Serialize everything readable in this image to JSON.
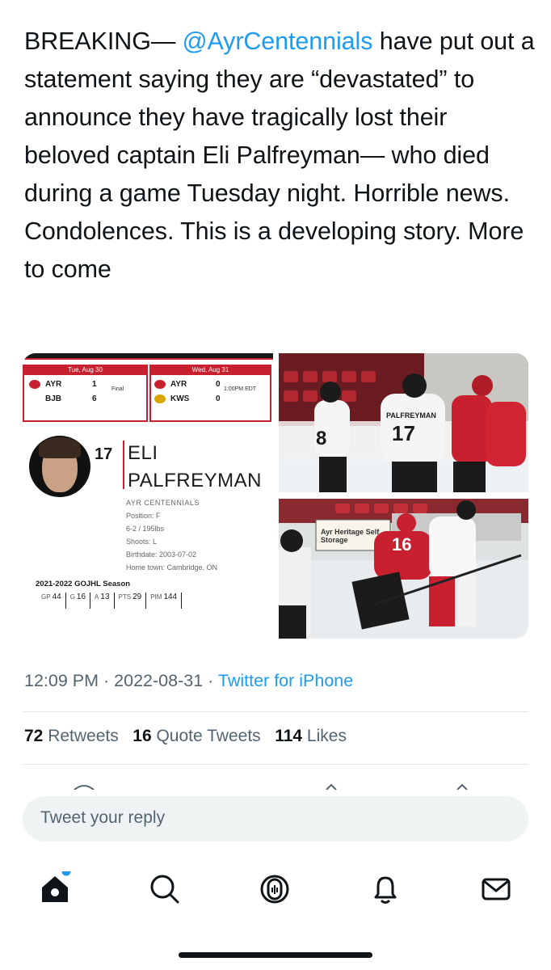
{
  "tweet": {
    "text_before": "BREAKING— ",
    "mention": "@AyrCentennials",
    "text_after": " have put out a statement saying they are “devastated” to announce they have tragically lost their beloved captain Eli Palfreyman— who died during a game Tuesday night. Horrible news. Condolences. This is a developing story. More to come"
  },
  "media": {
    "scoreboard": {
      "games": [
        {
          "date": "Tue, Aug 30",
          "home": "AYR",
          "home_score": "1",
          "away": "BJB",
          "away_score": "6",
          "status": "Final"
        },
        {
          "date": "Wed, Aug 31",
          "home": "AYR",
          "home_score": "0",
          "away": "KWS",
          "away_score": "0",
          "status": "1:00PM EDT"
        }
      ]
    },
    "player": {
      "number": "17",
      "first_name": "ELI",
      "last_name": "PALFREYMAN",
      "team": "AYR CENTENNIALS",
      "position": "Position: F",
      "size": "6-2 / 195lbs",
      "shoots": "Shoots: L",
      "birthdate": "Birthdate: 2003-07-02",
      "hometown": "Home town: Cambridge, ON",
      "season_label": "2021-2022 GOJHL Season",
      "stats": [
        {
          "label": "GP",
          "value": "44"
        },
        {
          "label": "G",
          "value": "16"
        },
        {
          "label": "A",
          "value": "13"
        },
        {
          "label": "PTS",
          "value": "29"
        },
        {
          "label": "PIM",
          "value": "144"
        }
      ]
    },
    "photo_top": {
      "jersey_name": "PALFREYMAN",
      "jersey_number": "17",
      "other_number": "8"
    },
    "photo_bottom": {
      "sign_text": "Ayr Heritage Self Storage",
      "jersey_number": "16"
    }
  },
  "meta": {
    "time": "12:09 PM",
    "date": "2022-08-31",
    "separator": "·",
    "client": "Twitter for iPhone"
  },
  "engagement": {
    "retweets_count": "72",
    "retweets_label": "Retweets",
    "quotes_count": "16",
    "quotes_label": "Quote Tweets",
    "likes_count": "114",
    "likes_label": "Likes"
  },
  "reply": {
    "placeholder": "Tweet your reply"
  },
  "tabbar": {
    "items": [
      "home-icon",
      "search-icon",
      "spaces-icon",
      "notifications-icon",
      "messages-icon"
    ],
    "accent": "#1d9bf0"
  },
  "colors": {
    "accent": "#1d9bf0",
    "text": "#0f1419",
    "secondary": "#536471",
    "team_red": "#c8202e"
  }
}
